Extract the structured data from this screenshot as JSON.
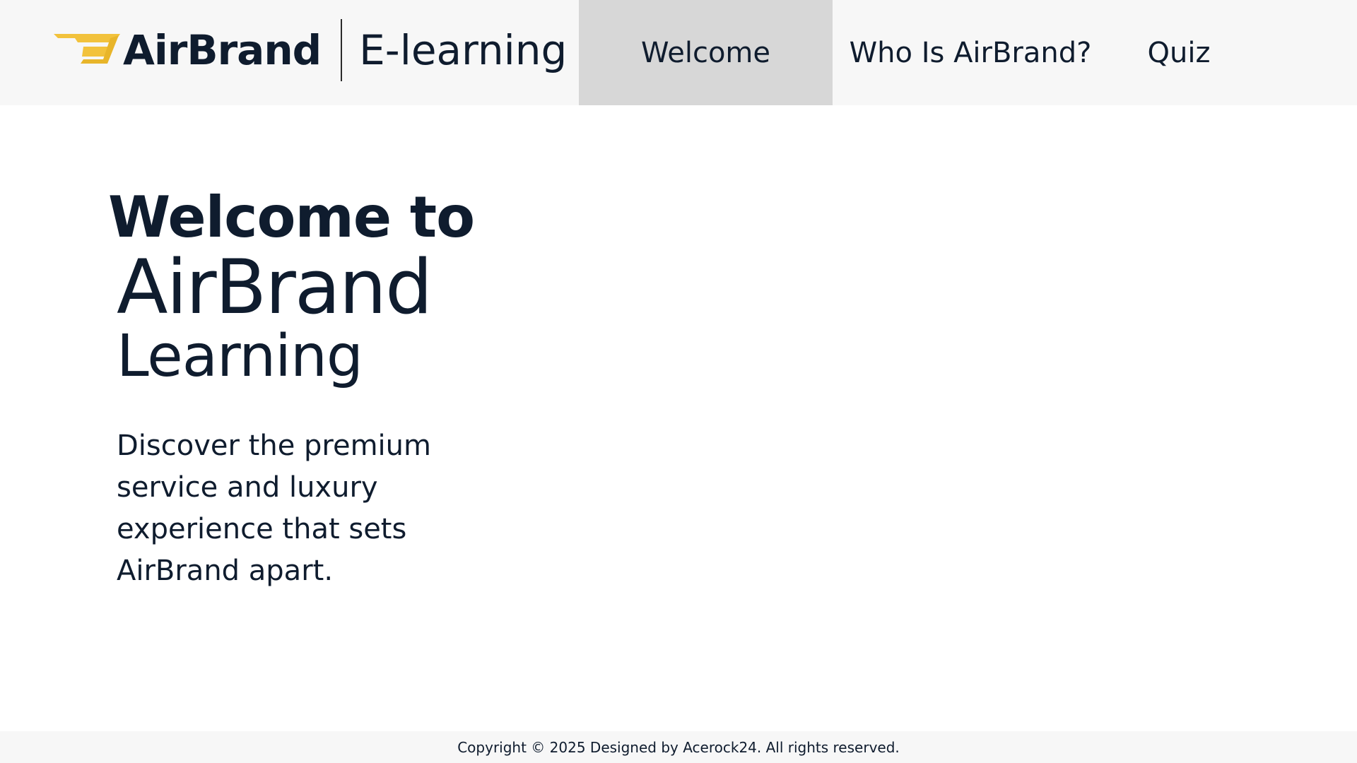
{
  "header": {
    "logo_text": "AirBrand",
    "logo_icon": "airbrand-wing-logo",
    "sub_title": "E-learning",
    "accent_color": "#f2c23c"
  },
  "nav": {
    "items": [
      {
        "label": "Welcome",
        "active": true
      },
      {
        "label": "Who Is AirBrand?",
        "active": false
      },
      {
        "label": "Quiz",
        "active": false
      }
    ]
  },
  "hero": {
    "line1": "Welcome to",
    "line2": "AirBrand",
    "line3": "Learning",
    "description": "Discover the premium service and luxury experience that sets AirBrand apart."
  },
  "footer": {
    "copyright": "Copyright © 2025 Designed by Acerock24. All rights reserved."
  },
  "colors": {
    "text": "#0f1c2e",
    "header_bg": "#f7f7f7",
    "active_tab_bg": "#d7d7d7",
    "page_bg": "#ffffff"
  }
}
